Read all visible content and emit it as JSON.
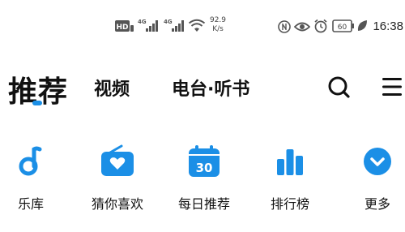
{
  "status_bar": {
    "hd_label": "HD",
    "sim1_label": "4G",
    "sim2_label": "4G",
    "net_speed_value": "92.9",
    "net_speed_unit": "K/s",
    "battery_level": "60",
    "time": "16:38",
    "icons": [
      "hd-icon",
      "signal-4g-icon",
      "signal-4g-icon",
      "wifi-icon",
      "nfc-icon",
      "eye-icon",
      "alarm-icon",
      "battery-icon",
      "leaf-icon"
    ]
  },
  "header": {
    "tabs": [
      {
        "label": "推荐",
        "active": true
      },
      {
        "label": "视频",
        "active": false
      },
      {
        "label": "电台·听书",
        "active": false
      }
    ],
    "actions": [
      "search-icon",
      "menu-icon"
    ]
  },
  "shortcuts": [
    {
      "label": "乐库",
      "icon": "music-note-icon"
    },
    {
      "label": "猜你喜欢",
      "icon": "radio-heart-icon"
    },
    {
      "label": "每日推荐",
      "icon": "calendar-icon",
      "icon_text": "30"
    },
    {
      "label": "排行榜",
      "icon": "ranking-bars-icon"
    },
    {
      "label": "更多",
      "icon": "more-chevron-icon"
    }
  ],
  "colors": {
    "accent": "#1b8fe6",
    "text": "#111111"
  }
}
